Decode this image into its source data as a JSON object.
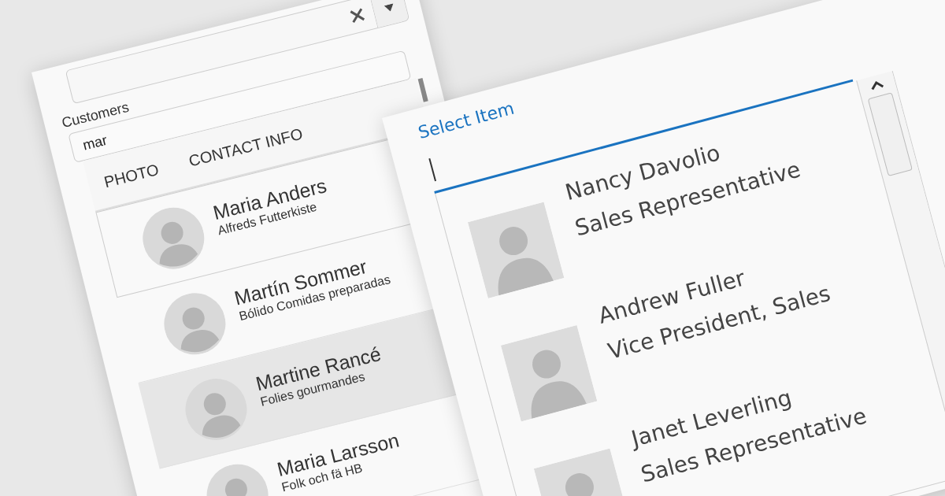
{
  "customers_combo": {
    "label": "Customers",
    "search": {
      "value": "mar"
    },
    "columns": [
      "PHOTO",
      "CONTACT INFO"
    ],
    "rows": [
      {
        "name": "Maria Anders",
        "company": "Alfreds Futterkiste",
        "focused": true,
        "selected": false
      },
      {
        "name": "Martín Sommer",
        "company": "Bólido Comidas preparadas",
        "focused": false,
        "selected": false
      },
      {
        "name": "Martine Rancé",
        "company": "Folies gourmandes",
        "focused": false,
        "selected": true
      },
      {
        "name": "Maria Larsson",
        "company": "Folk och fä HB",
        "focused": false,
        "selected": false
      }
    ]
  },
  "employee_picker": {
    "label": "Select Item",
    "rows": [
      {
        "name": "Nancy Davolio",
        "title": "Sales Representative"
      },
      {
        "name": "Andrew Fuller",
        "title": "Vice President, Sales"
      },
      {
        "name": "Janet Leverling",
        "title": "Sales Representative"
      }
    ]
  }
}
